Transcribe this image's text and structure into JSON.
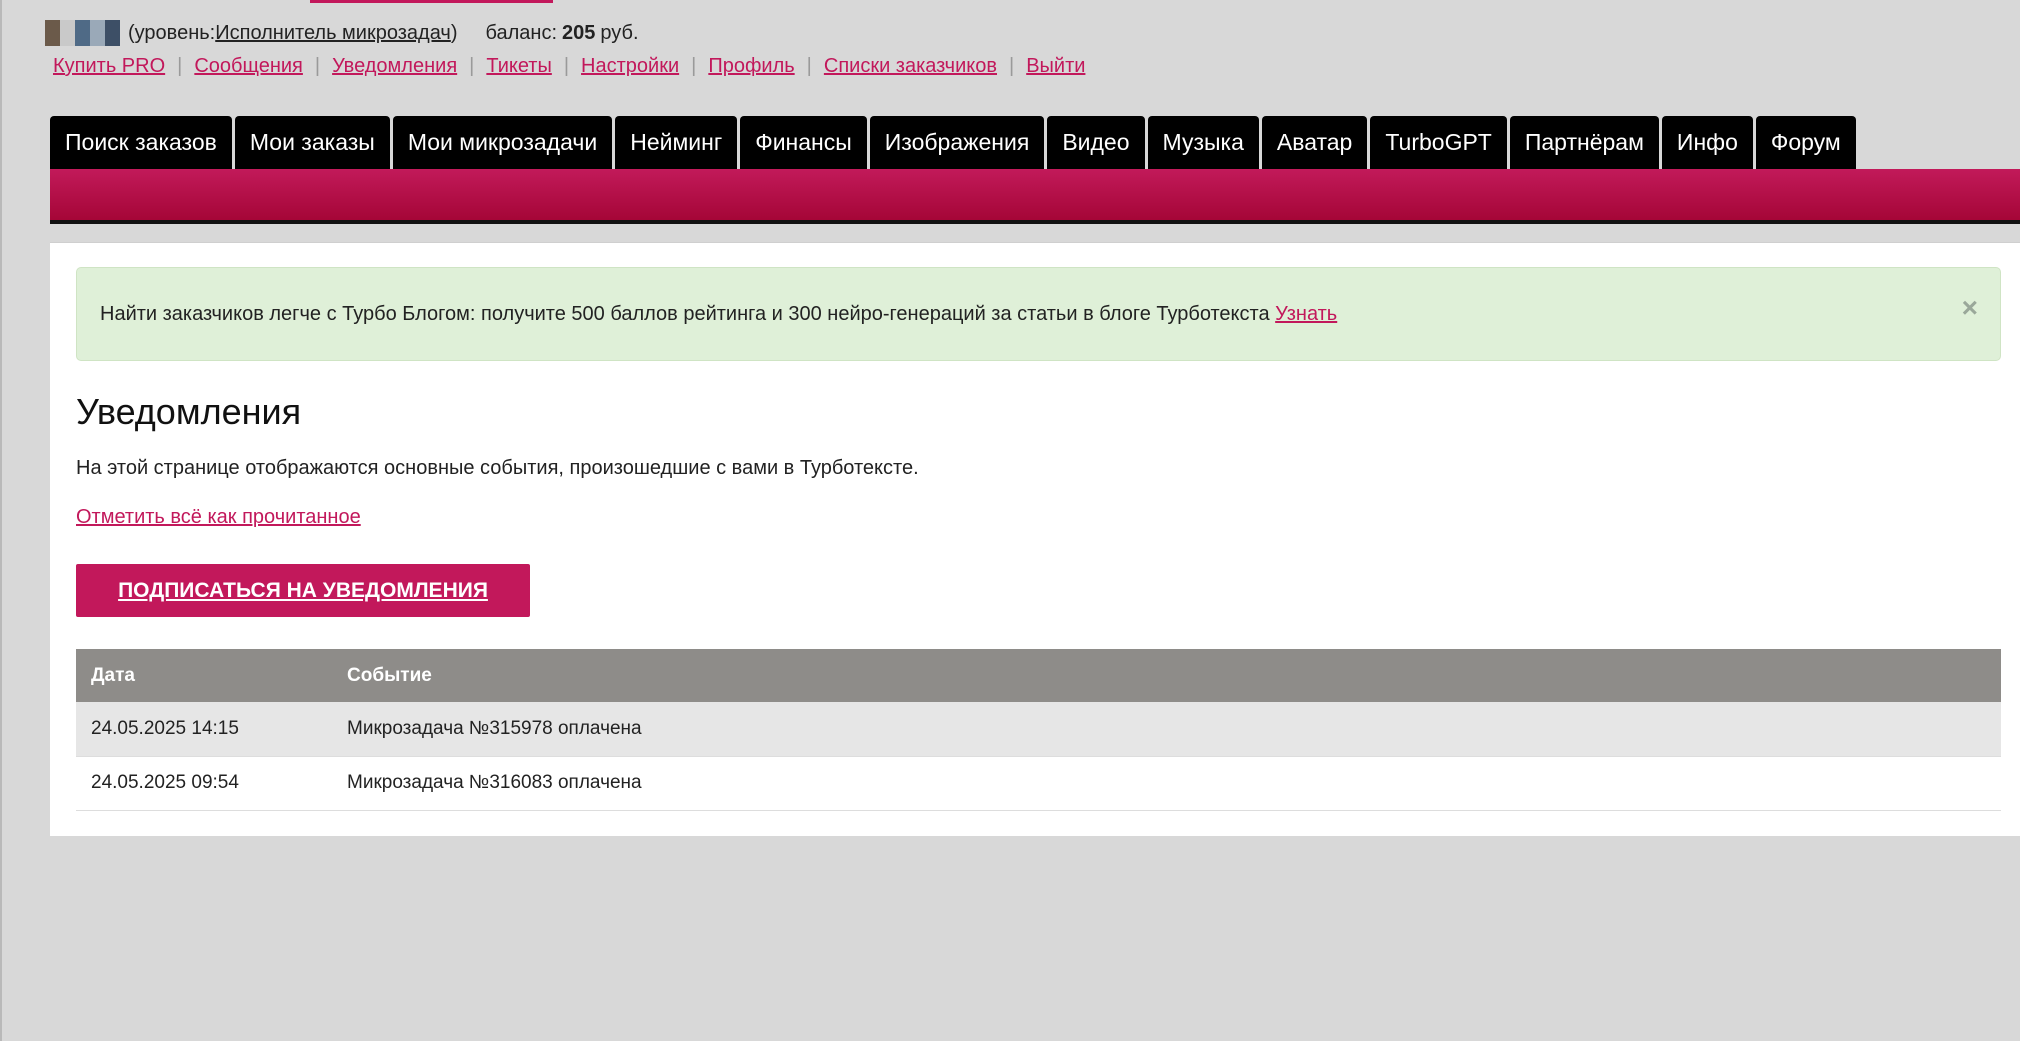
{
  "header": {
    "level_prefix": "(уровень: ",
    "level_link": "Исполнитель микрозадач",
    "level_suffix": ")",
    "balance_label": "баланс:",
    "balance_value": "205",
    "balance_unit": "руб."
  },
  "top_links": [
    "Купить PRO",
    "Сообщения",
    "Уведомления",
    "Тикеты",
    "Настройки",
    "Профиль",
    "Списки заказчиков",
    "Выйти"
  ],
  "tabs": [
    "Поиск заказов",
    "Мои заказы",
    "Мои микрозадачи",
    "Нейминг",
    "Финансы",
    "Изображения",
    "Видео",
    "Музыка",
    "Аватар",
    "TurboGPT",
    "Партнёрам",
    "Инфо",
    "Форум"
  ],
  "alert": {
    "text": "Найти заказчиков легче с Турбо Блогом: получите 500 баллов рейтинга и 300 нейро-генераций за статьи в блоге Турботекста",
    "link": "Узнать",
    "close": "×"
  },
  "page": {
    "title": "Уведомления",
    "intro": "На этой странице отображаются основные события, произошедшие с вами в Турботексте.",
    "mark_all_read": "Отметить всё как прочитанное",
    "subscribe_button": "ПОДПИСАТЬСЯ НА УВЕДОМЛЕНИЯ"
  },
  "table": {
    "columns": [
      "Дата",
      "Событие"
    ],
    "rows": [
      [
        "24.05.2025 14:15",
        "Микрозадача №315978 оплачена"
      ],
      [
        "24.05.2025 09:54",
        "Микрозадача №316083 оплачена"
      ]
    ]
  },
  "colors": {
    "accent": "#c2185b",
    "tabbar_dark": "#a50637",
    "alert_bg": "#dff0d8",
    "table_header": "#8e8c89"
  }
}
